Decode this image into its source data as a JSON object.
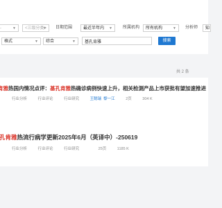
{
  "filters": {
    "row1": {
      "date_start_placeholder": "-",
      "date_end_placeholder": "<三级分类>",
      "date_label": "日期范围",
      "date_range": "最近半年内",
      "org_label": "所属机构",
      "org_value": "所有机构",
      "analyst_label": "分析师",
      "analyst_value": "知"
    },
    "row2": {
      "format": "格式",
      "sort": "综合",
      "keyword": "基孔肯雅",
      "search_label": "搜索"
    }
  },
  "pager": "共 2 条",
  "results": [
    {
      "title_highlight_1": "肯雅",
      "title_part_1": "热国内情况点评：",
      "title_highlight_2": "基孔肯雅",
      "title_part_2": "热确诊病例快速上升，相关检测产品上市获批有望加速推进",
      "tags": [
        "行业分析",
        "行业评论",
        "行业研究"
      ],
      "author_1": "王聪瑞",
      "author_2": "黎一江",
      "pages": "2页",
      "size": "304 K"
    },
    {
      "title_highlight_1": "孔肯雅",
      "title_part_1": "热流行病学更新2025年6月（英译中）-250619",
      "tags": [
        "行业分析",
        "行业评论",
        "行业研究"
      ],
      "pages": "25页",
      "size": "1185 K"
    }
  ],
  "colors": {
    "highlight": "#d93025",
    "button": "#1f78d1"
  }
}
